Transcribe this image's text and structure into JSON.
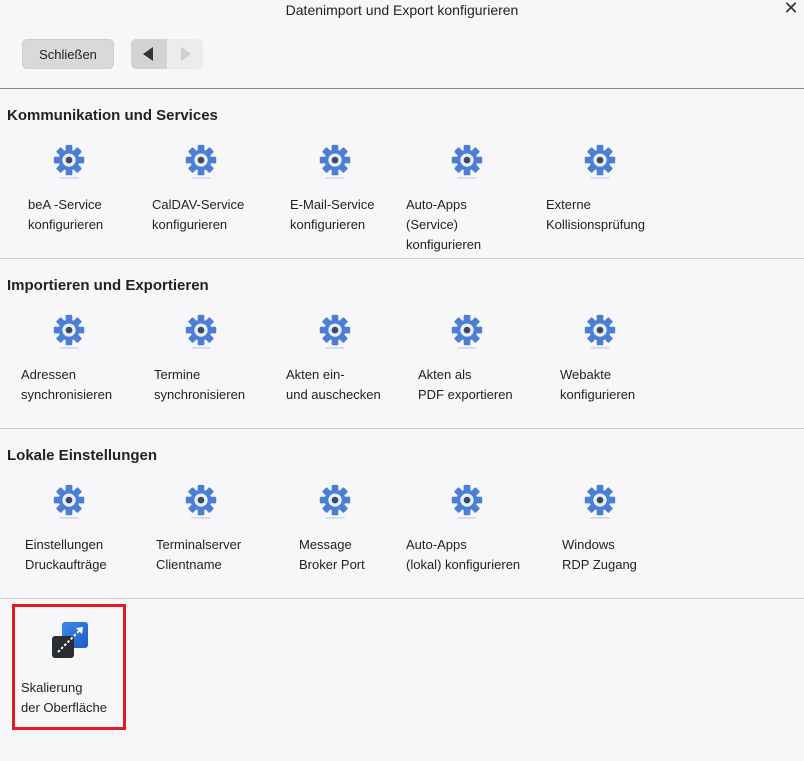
{
  "window": {
    "title": "Datenimport und Export konfigurieren",
    "close_glyph": "✕"
  },
  "toolbar": {
    "close_label": "Schließen",
    "back_icon": "arrow-left-icon",
    "forward_icon": "arrow-right-icon"
  },
  "sections": [
    {
      "title": "Kommunikation und Services",
      "items": [
        {
          "label": "beA -Service\nkonfigurieren",
          "icon": "gear-icon"
        },
        {
          "label": "CalDAV-Service\nkonfigurieren",
          "icon": "gear-icon"
        },
        {
          "label": "E-Mail-Service\nkonfigurieren",
          "icon": "gear-icon"
        },
        {
          "label": "Auto-Apps\n(Service)\nkonfigurieren",
          "icon": "gear-icon"
        },
        {
          "label": "Externe\nKollisionsprüfung",
          "icon": "gear-icon"
        }
      ]
    },
    {
      "title": "Importieren und Exportieren",
      "items": [
        {
          "label": "Adressen\nsynchronisieren",
          "icon": "gear-icon"
        },
        {
          "label": "Termine\nsynchronisieren",
          "icon": "gear-icon"
        },
        {
          "label": "Akten ein-\nund auschecken",
          "icon": "gear-icon"
        },
        {
          "label": "Akten als\nPDF exportieren",
          "icon": "gear-icon"
        },
        {
          "label": "Webakte\nkonfigurieren",
          "icon": "gear-icon"
        }
      ]
    },
    {
      "title": "Lokale Einstellungen",
      "items": [
        {
          "label": "Einstellungen\nDruckaufträge",
          "icon": "gear-icon"
        },
        {
          "label": "Terminalserver\nClientname",
          "icon": "gear-icon"
        },
        {
          "label": "Message\nBroker Port",
          "icon": "gear-icon"
        },
        {
          "label": "Auto-Apps\n(lokal) konfigurieren",
          "icon": "gear-icon"
        },
        {
          "label": "Windows\nRDP Zugang",
          "icon": "gear-icon"
        }
      ]
    }
  ],
  "extra": {
    "label": "Skalierung\nder Oberfläche",
    "icon": "scaling-icon"
  },
  "colors": {
    "gear": "#4a7fd4",
    "highlight": "#e01b24"
  }
}
